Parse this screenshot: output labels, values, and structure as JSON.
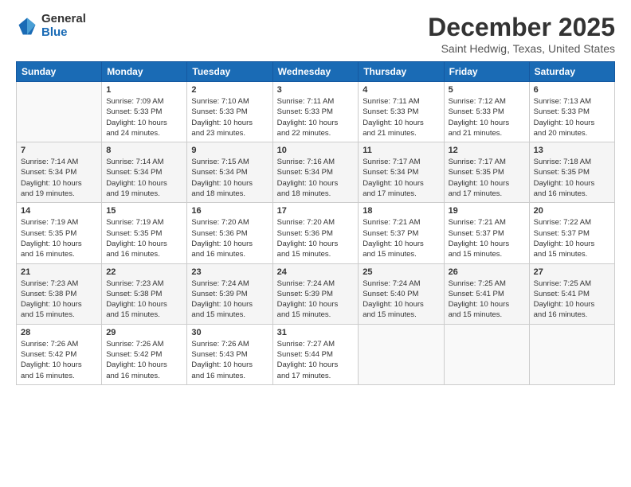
{
  "logo": {
    "general": "General",
    "blue": "Blue"
  },
  "header": {
    "title": "December 2025",
    "subtitle": "Saint Hedwig, Texas, United States"
  },
  "weekdays": [
    "Sunday",
    "Monday",
    "Tuesday",
    "Wednesday",
    "Thursday",
    "Friday",
    "Saturday"
  ],
  "weeks": [
    [
      {
        "day": "",
        "info": ""
      },
      {
        "day": "1",
        "info": "Sunrise: 7:09 AM\nSunset: 5:33 PM\nDaylight: 10 hours\nand 24 minutes."
      },
      {
        "day": "2",
        "info": "Sunrise: 7:10 AM\nSunset: 5:33 PM\nDaylight: 10 hours\nand 23 minutes."
      },
      {
        "day": "3",
        "info": "Sunrise: 7:11 AM\nSunset: 5:33 PM\nDaylight: 10 hours\nand 22 minutes."
      },
      {
        "day": "4",
        "info": "Sunrise: 7:11 AM\nSunset: 5:33 PM\nDaylight: 10 hours\nand 21 minutes."
      },
      {
        "day": "5",
        "info": "Sunrise: 7:12 AM\nSunset: 5:33 PM\nDaylight: 10 hours\nand 21 minutes."
      },
      {
        "day": "6",
        "info": "Sunrise: 7:13 AM\nSunset: 5:33 PM\nDaylight: 10 hours\nand 20 minutes."
      }
    ],
    [
      {
        "day": "7",
        "info": "Sunrise: 7:14 AM\nSunset: 5:34 PM\nDaylight: 10 hours\nand 19 minutes."
      },
      {
        "day": "8",
        "info": "Sunrise: 7:14 AM\nSunset: 5:34 PM\nDaylight: 10 hours\nand 19 minutes."
      },
      {
        "day": "9",
        "info": "Sunrise: 7:15 AM\nSunset: 5:34 PM\nDaylight: 10 hours\nand 18 minutes."
      },
      {
        "day": "10",
        "info": "Sunrise: 7:16 AM\nSunset: 5:34 PM\nDaylight: 10 hours\nand 18 minutes."
      },
      {
        "day": "11",
        "info": "Sunrise: 7:17 AM\nSunset: 5:34 PM\nDaylight: 10 hours\nand 17 minutes."
      },
      {
        "day": "12",
        "info": "Sunrise: 7:17 AM\nSunset: 5:35 PM\nDaylight: 10 hours\nand 17 minutes."
      },
      {
        "day": "13",
        "info": "Sunrise: 7:18 AM\nSunset: 5:35 PM\nDaylight: 10 hours\nand 16 minutes."
      }
    ],
    [
      {
        "day": "14",
        "info": "Sunrise: 7:19 AM\nSunset: 5:35 PM\nDaylight: 10 hours\nand 16 minutes."
      },
      {
        "day": "15",
        "info": "Sunrise: 7:19 AM\nSunset: 5:35 PM\nDaylight: 10 hours\nand 16 minutes."
      },
      {
        "day": "16",
        "info": "Sunrise: 7:20 AM\nSunset: 5:36 PM\nDaylight: 10 hours\nand 16 minutes."
      },
      {
        "day": "17",
        "info": "Sunrise: 7:20 AM\nSunset: 5:36 PM\nDaylight: 10 hours\nand 15 minutes."
      },
      {
        "day": "18",
        "info": "Sunrise: 7:21 AM\nSunset: 5:37 PM\nDaylight: 10 hours\nand 15 minutes."
      },
      {
        "day": "19",
        "info": "Sunrise: 7:21 AM\nSunset: 5:37 PM\nDaylight: 10 hours\nand 15 minutes."
      },
      {
        "day": "20",
        "info": "Sunrise: 7:22 AM\nSunset: 5:37 PM\nDaylight: 10 hours\nand 15 minutes."
      }
    ],
    [
      {
        "day": "21",
        "info": "Sunrise: 7:23 AM\nSunset: 5:38 PM\nDaylight: 10 hours\nand 15 minutes."
      },
      {
        "day": "22",
        "info": "Sunrise: 7:23 AM\nSunset: 5:38 PM\nDaylight: 10 hours\nand 15 minutes."
      },
      {
        "day": "23",
        "info": "Sunrise: 7:24 AM\nSunset: 5:39 PM\nDaylight: 10 hours\nand 15 minutes."
      },
      {
        "day": "24",
        "info": "Sunrise: 7:24 AM\nSunset: 5:39 PM\nDaylight: 10 hours\nand 15 minutes."
      },
      {
        "day": "25",
        "info": "Sunrise: 7:24 AM\nSunset: 5:40 PM\nDaylight: 10 hours\nand 15 minutes."
      },
      {
        "day": "26",
        "info": "Sunrise: 7:25 AM\nSunset: 5:41 PM\nDaylight: 10 hours\nand 15 minutes."
      },
      {
        "day": "27",
        "info": "Sunrise: 7:25 AM\nSunset: 5:41 PM\nDaylight: 10 hours\nand 16 minutes."
      }
    ],
    [
      {
        "day": "28",
        "info": "Sunrise: 7:26 AM\nSunset: 5:42 PM\nDaylight: 10 hours\nand 16 minutes."
      },
      {
        "day": "29",
        "info": "Sunrise: 7:26 AM\nSunset: 5:42 PM\nDaylight: 10 hours\nand 16 minutes."
      },
      {
        "day": "30",
        "info": "Sunrise: 7:26 AM\nSunset: 5:43 PM\nDaylight: 10 hours\nand 16 minutes."
      },
      {
        "day": "31",
        "info": "Sunrise: 7:27 AM\nSunset: 5:44 PM\nDaylight: 10 hours\nand 17 minutes."
      },
      {
        "day": "",
        "info": ""
      },
      {
        "day": "",
        "info": ""
      },
      {
        "day": "",
        "info": ""
      }
    ]
  ]
}
